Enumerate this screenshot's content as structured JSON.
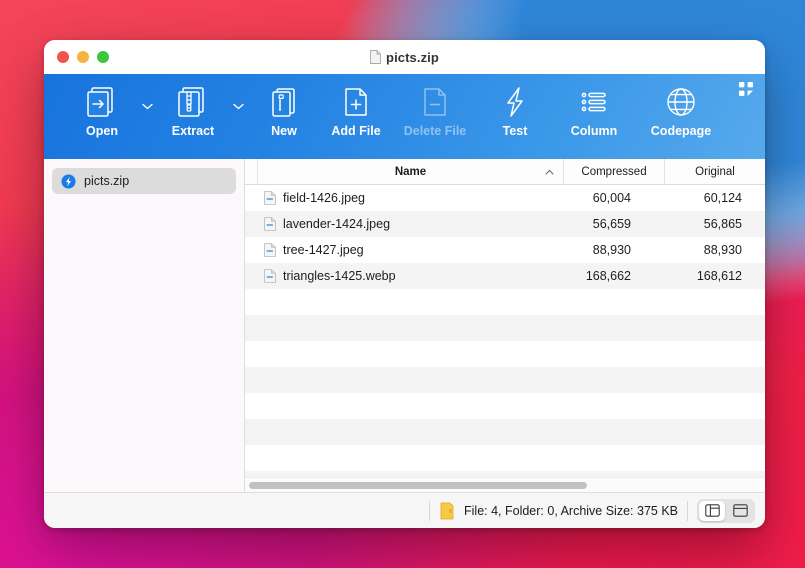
{
  "window": {
    "title": "picts.zip",
    "title_icon": "document-icon",
    "traffic_lights": [
      "close-button",
      "minimize-button",
      "zoom-button"
    ]
  },
  "toolbar": {
    "items": [
      {
        "label": "Open",
        "icon": "open-archive-icon",
        "disabled": false,
        "has_caret": true
      },
      {
        "label": "Extract",
        "icon": "extract-zipper-icon",
        "disabled": false,
        "has_caret": true
      },
      {
        "label": "New",
        "icon": "new-archive-icon",
        "disabled": false,
        "has_caret": false
      },
      {
        "label": "Add File",
        "icon": "add-file-icon",
        "disabled": false,
        "has_caret": false
      },
      {
        "label": "Delete File",
        "icon": "delete-file-icon",
        "disabled": true,
        "has_caret": false
      },
      {
        "label": "Test",
        "icon": "lightning-bolt-icon",
        "disabled": false,
        "has_caret": false
      },
      {
        "label": "Column",
        "icon": "list-columns-icon",
        "disabled": false,
        "has_caret": false
      },
      {
        "label": "Codepage",
        "icon": "globe-icon",
        "disabled": false,
        "has_caret": false
      }
    ],
    "overflow_icon": "grid-overflow-icon"
  },
  "sidebar": {
    "items": [
      {
        "label": "picts.zip",
        "icon": "zip-bolt-icon",
        "selected": true
      }
    ]
  },
  "file_list": {
    "columns": [
      {
        "key": "name",
        "label": "Name",
        "sort": "ascending"
      },
      {
        "key": "compressed",
        "label": "Compressed",
        "sort": "none"
      },
      {
        "key": "original",
        "label": "Original",
        "sort": "none"
      }
    ],
    "rows": [
      {
        "icon": "file-icon",
        "name": "field-1426.jpeg",
        "compressed": "60,004",
        "original": "60,124"
      },
      {
        "icon": "file-icon",
        "name": "lavender-1424.jpeg",
        "compressed": "56,659",
        "original": "56,865"
      },
      {
        "icon": "file-icon",
        "name": "tree-1427.jpeg",
        "compressed": "88,930",
        "original": "88,930"
      },
      {
        "icon": "file-icon",
        "name": "triangles-1425.webp",
        "compressed": "168,662",
        "original": "168,612"
      }
    ],
    "empty_row_count": 8
  },
  "statusbar": {
    "folder_icon": "yellow-folder-icon",
    "summary": "File: 4, Folder: 0, Archive Size: 375 KB",
    "view_toggles": [
      {
        "icon": "sidebar-layout-icon",
        "active": true
      },
      {
        "icon": "split-layout-icon",
        "active": false
      }
    ]
  },
  "colors": {
    "toolbar_blue": "#2482e3",
    "selection_gray": "#dddcdd",
    "zebra_row": "#f4f4f4"
  }
}
